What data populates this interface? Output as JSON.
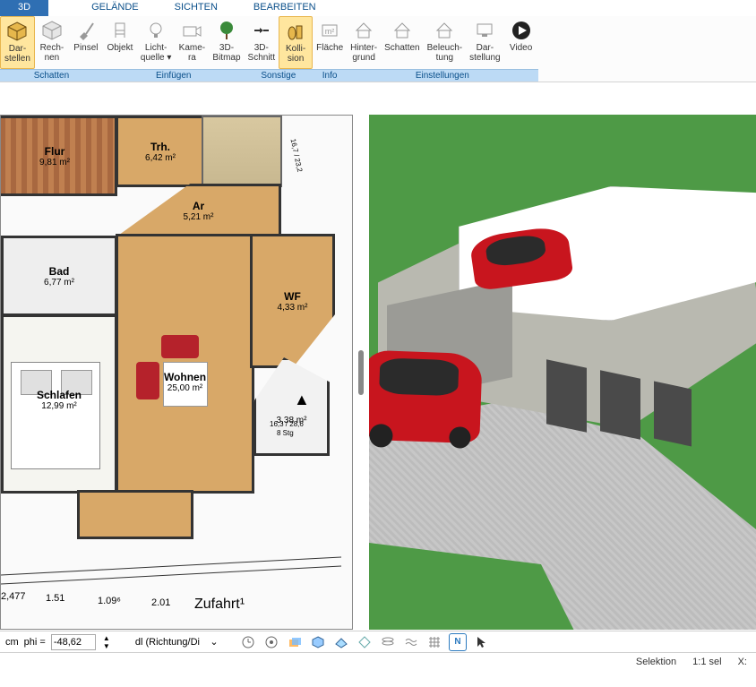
{
  "tabs": [
    {
      "label": "3D",
      "active": true
    },
    {
      "label": "GELÄNDE"
    },
    {
      "label": "SICHTEN"
    },
    {
      "label": "BEARBEITEN"
    }
  ],
  "ribbon": {
    "groups": [
      {
        "label": "Schatten",
        "buttons": [
          {
            "label1": "Dar-",
            "label2": "stellen",
            "active": true,
            "name": "darstellen-button",
            "icon": "cube-yellow"
          },
          {
            "label1": "Rech-",
            "label2": "nen",
            "name": "rechnen-button",
            "icon": "cube-gray"
          },
          {
            "label1": "Pinsel",
            "label2": "",
            "name": "pinsel-button",
            "icon": "brush"
          }
        ]
      },
      {
        "label": "Einfügen",
        "buttons": [
          {
            "label1": "Objekt",
            "label2": "",
            "name": "objekt-button",
            "icon": "chair"
          },
          {
            "label1": "Licht-",
            "label2": "quelle ▾",
            "name": "lichtquelle-button",
            "icon": "bulb"
          },
          {
            "label1": "Kame-",
            "label2": "ra",
            "name": "kamera-button",
            "icon": "camera"
          },
          {
            "label1": "3D-",
            "label2": "Bitmap",
            "name": "bitmap-button",
            "icon": "tree"
          }
        ]
      },
      {
        "label": "Sonstige",
        "buttons": [
          {
            "label1": "3D-",
            "label2": "Schnitt",
            "name": "schnitt-button",
            "icon": "arrows-in"
          },
          {
            "label1": "Kolli-",
            "label2": "sion",
            "active": true,
            "name": "kollision-button",
            "icon": "collision"
          }
        ]
      },
      {
        "label": "Info",
        "buttons": [
          {
            "label1": "Fläche",
            "label2": "",
            "name": "flaeche-button",
            "icon": "flaeche"
          }
        ]
      },
      {
        "label": "Einstellungen",
        "buttons": [
          {
            "label1": "Hinter-",
            "label2": "grund",
            "name": "hintergrund-button",
            "icon": "house"
          },
          {
            "label1": "Schatten",
            "label2": "",
            "name": "schatten-button",
            "icon": "house"
          },
          {
            "label1": "Beleuch-",
            "label2": "tung",
            "name": "beleuchtung-button",
            "icon": "house"
          },
          {
            "label1": "Dar-",
            "label2": "stellung",
            "name": "darstellung-button",
            "icon": "monitor"
          },
          {
            "label1": "Video",
            "label2": "",
            "name": "video-button",
            "icon": "play"
          }
        ]
      }
    ]
  },
  "rooms": {
    "flur": {
      "name": "Flur",
      "area": "9,81 m²"
    },
    "trh": {
      "name": "Trh.",
      "area": "6,42 m²"
    },
    "ar": {
      "name": "Ar",
      "area": "5,21 m²"
    },
    "bad": {
      "name": "Bad",
      "area": "6,77 m²"
    },
    "wf": {
      "name": "WF",
      "area": "4,33 m²"
    },
    "wohnen": {
      "name": "Wohnen",
      "area": "25,00 m²"
    },
    "schlafen": {
      "name": "Schlafen",
      "area": "12,99 m²"
    },
    "unnamed": {
      "name": "",
      "area": "3,38 m²"
    }
  },
  "dims": {
    "d1": "2,477",
    "d2": "1.51",
    "d3": "1.09⁶",
    "d4": "2.01",
    "d5": "Zufahrt¹",
    "side1": "16,7 / 23,2",
    "side2": "16,3 / 28,6",
    "side3": "8 Stg"
  },
  "bottombar": {
    "unit": "cm",
    "phi_label": "phi =",
    "phi_value": "-48,62",
    "mode_label": "dl (Richtung/Di"
  },
  "status": {
    "sel": "Selektion",
    "scale": "1:1 sel",
    "x": "X:"
  }
}
